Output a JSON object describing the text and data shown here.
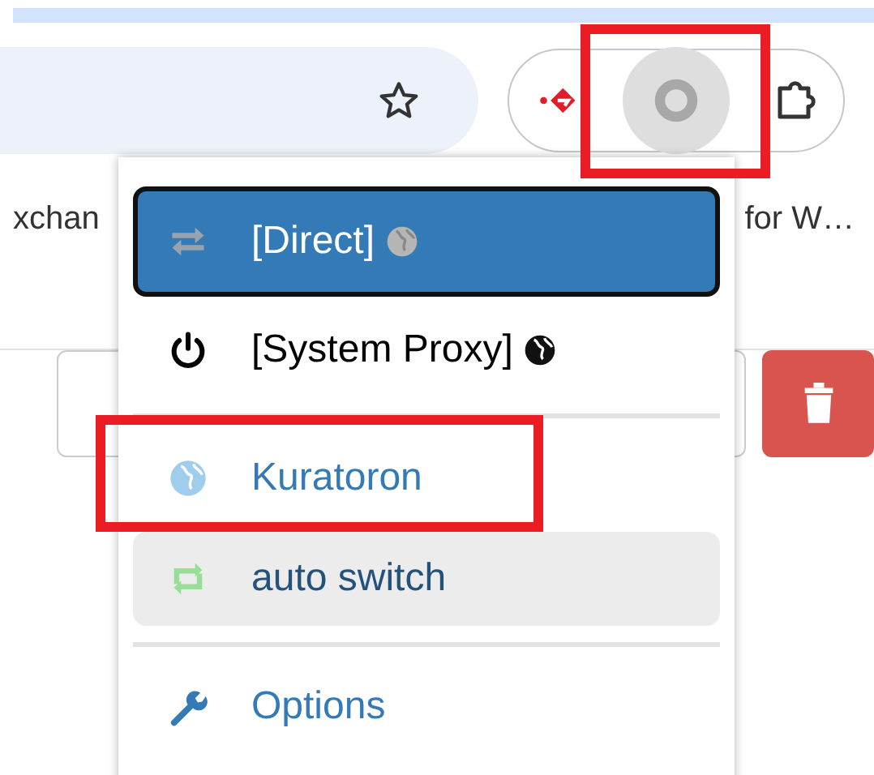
{
  "bookmarks": [
    {
      "label": "xchan"
    },
    {
      "label": "for W…"
    }
  ],
  "menu": {
    "items": [
      {
        "kind": "direct",
        "label": "[Direct]",
        "selected": true,
        "hovered": false,
        "globe": true,
        "annotated": false
      },
      {
        "kind": "system",
        "label": "[System Proxy]",
        "selected": false,
        "hovered": false,
        "globe": true,
        "annotated": false
      },
      {
        "kind": "separator"
      },
      {
        "kind": "profile",
        "label": "Kuratoron",
        "selected": false,
        "hovered": false,
        "globe": false,
        "annotated": true
      },
      {
        "kind": "switch",
        "label": "auto switch",
        "selected": false,
        "hovered": true,
        "globe": false,
        "annotated": false
      },
      {
        "kind": "separator"
      },
      {
        "kind": "options",
        "label": "Options",
        "selected": false,
        "hovered": false,
        "globe": false,
        "annotated": false
      }
    ]
  }
}
